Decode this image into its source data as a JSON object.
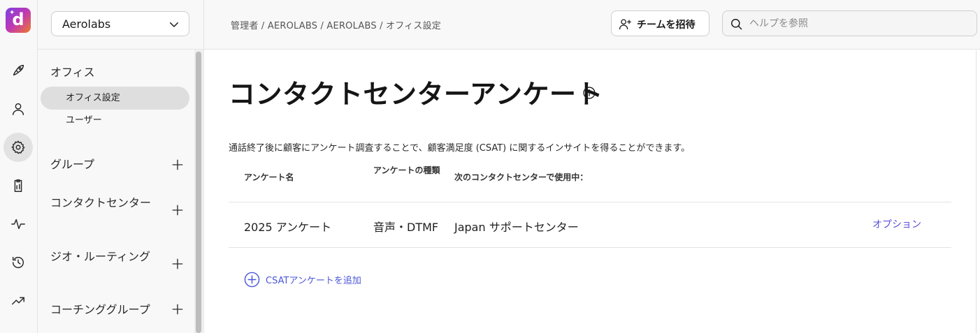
{
  "app": {
    "logo_letter": "d"
  },
  "rail": {
    "items": [
      {
        "name": "rocket-icon"
      },
      {
        "name": "person-icon"
      },
      {
        "name": "gear-icon",
        "active": true
      },
      {
        "name": "clipboard-icon"
      },
      {
        "name": "activity-icon"
      },
      {
        "name": "history-icon"
      },
      {
        "name": "trending-up-icon"
      }
    ]
  },
  "sidebar": {
    "org_select": {
      "value": "Aerolabs"
    },
    "office_section": {
      "label": "オフィス",
      "items": [
        {
          "label": "オフィス設定",
          "active": true
        },
        {
          "label": "ユーザー",
          "active": false
        }
      ]
    },
    "groups": [
      {
        "label": "グループ"
      },
      {
        "label": "コンタクトセンター"
      },
      {
        "label": "ジオ・ルーティング"
      },
      {
        "label": "コーチンググループ"
      }
    ]
  },
  "header": {
    "breadcrumb": "管理者 / AEROLABS / AEROLABS / オフィス設定",
    "invite_label": "チームを招待",
    "search_placeholder": "ヘルプを参照"
  },
  "main": {
    "title": "コンタクトセンターアンケート",
    "description": "通話終了後に顧客にアンケート調査することで、顧客満足度 (CSAT) に関するインサイトを得ることができます。",
    "table": {
      "headers": [
        "アンケート名",
        "アンケートの種類",
        "次のコンタクトセンターで使用中："
      ],
      "rows": [
        {
          "name": "2025 アンケート",
          "type": "音声・DTMF",
          "used_in": "Japan サポートセンター",
          "action": "オプション"
        }
      ]
    },
    "add_label": "CSATアンケートを追加"
  },
  "colors": {
    "accent": "#5b50d8",
    "link": "#4a56d8",
    "active_bg": "#dedede"
  }
}
